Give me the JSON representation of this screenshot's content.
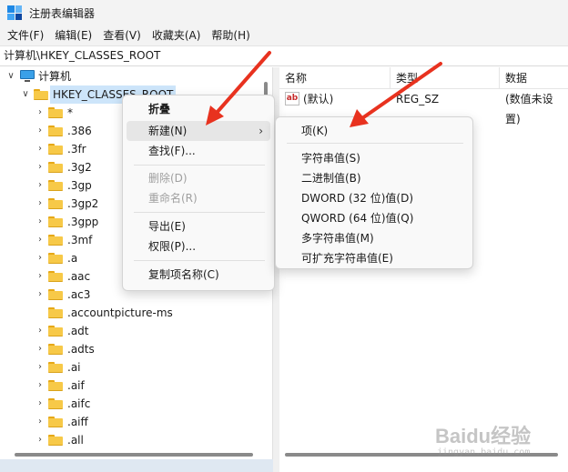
{
  "window": {
    "title": "注册表编辑器"
  },
  "menubar": [
    {
      "label": "文件(F)"
    },
    {
      "label": "编辑(E)"
    },
    {
      "label": "查看(V)"
    },
    {
      "label": "收藏夹(A)"
    },
    {
      "label": "帮助(H)"
    }
  ],
  "address": "计算机\\HKEY_CLASSES_ROOT",
  "tree": {
    "root": "计算机",
    "hkcr": "HKEY_CLASSES_ROOT",
    "children": [
      "*",
      ".386",
      ".3fr",
      ".3g2",
      ".3gp",
      ".3gp2",
      ".3gpp",
      ".3mf",
      ".a",
      ".aac",
      ".ac3",
      ".accountpicture-ms",
      ".adt",
      ".adts",
      ".ai",
      ".aif",
      ".aifc",
      ".aiff",
      ".all"
    ]
  },
  "list": {
    "headers": [
      "名称",
      "类型",
      "数据"
    ],
    "rows": [
      {
        "name": "(默认)",
        "type": "REG_SZ",
        "data": "(数值未设置)"
      }
    ]
  },
  "context_menu": {
    "items": [
      {
        "label": "折叠"
      },
      {
        "label": "新建(N)"
      },
      {
        "label": "查找(F)..."
      },
      {
        "label": "删除(D)"
      },
      {
        "label": "重命名(R)"
      },
      {
        "label": "导出(E)"
      },
      {
        "label": "权限(P)..."
      },
      {
        "label": "复制项名称(C)"
      }
    ]
  },
  "submenu": {
    "items": [
      {
        "label": "项(K)"
      },
      {
        "label": "字符串值(S)"
      },
      {
        "label": "二进制值(B)"
      },
      {
        "label": "DWORD (32 位)值(D)"
      },
      {
        "label": "QWORD (64 位)值(Q)"
      },
      {
        "label": "多字符串值(M)"
      },
      {
        "label": "可扩充字符串值(E)"
      }
    ]
  },
  "watermark": {
    "main": "Baidu经验",
    "sub": "jingyan.baidu.com"
  },
  "colors": {
    "accent_arrow": "#e8321f",
    "selection": "#cde5fa",
    "folder": "#f7c948"
  },
  "icons": {
    "app": "regedit-icon",
    "folder": "folder-icon",
    "computer": "computer-icon",
    "string_value": "reg-sz-icon"
  }
}
